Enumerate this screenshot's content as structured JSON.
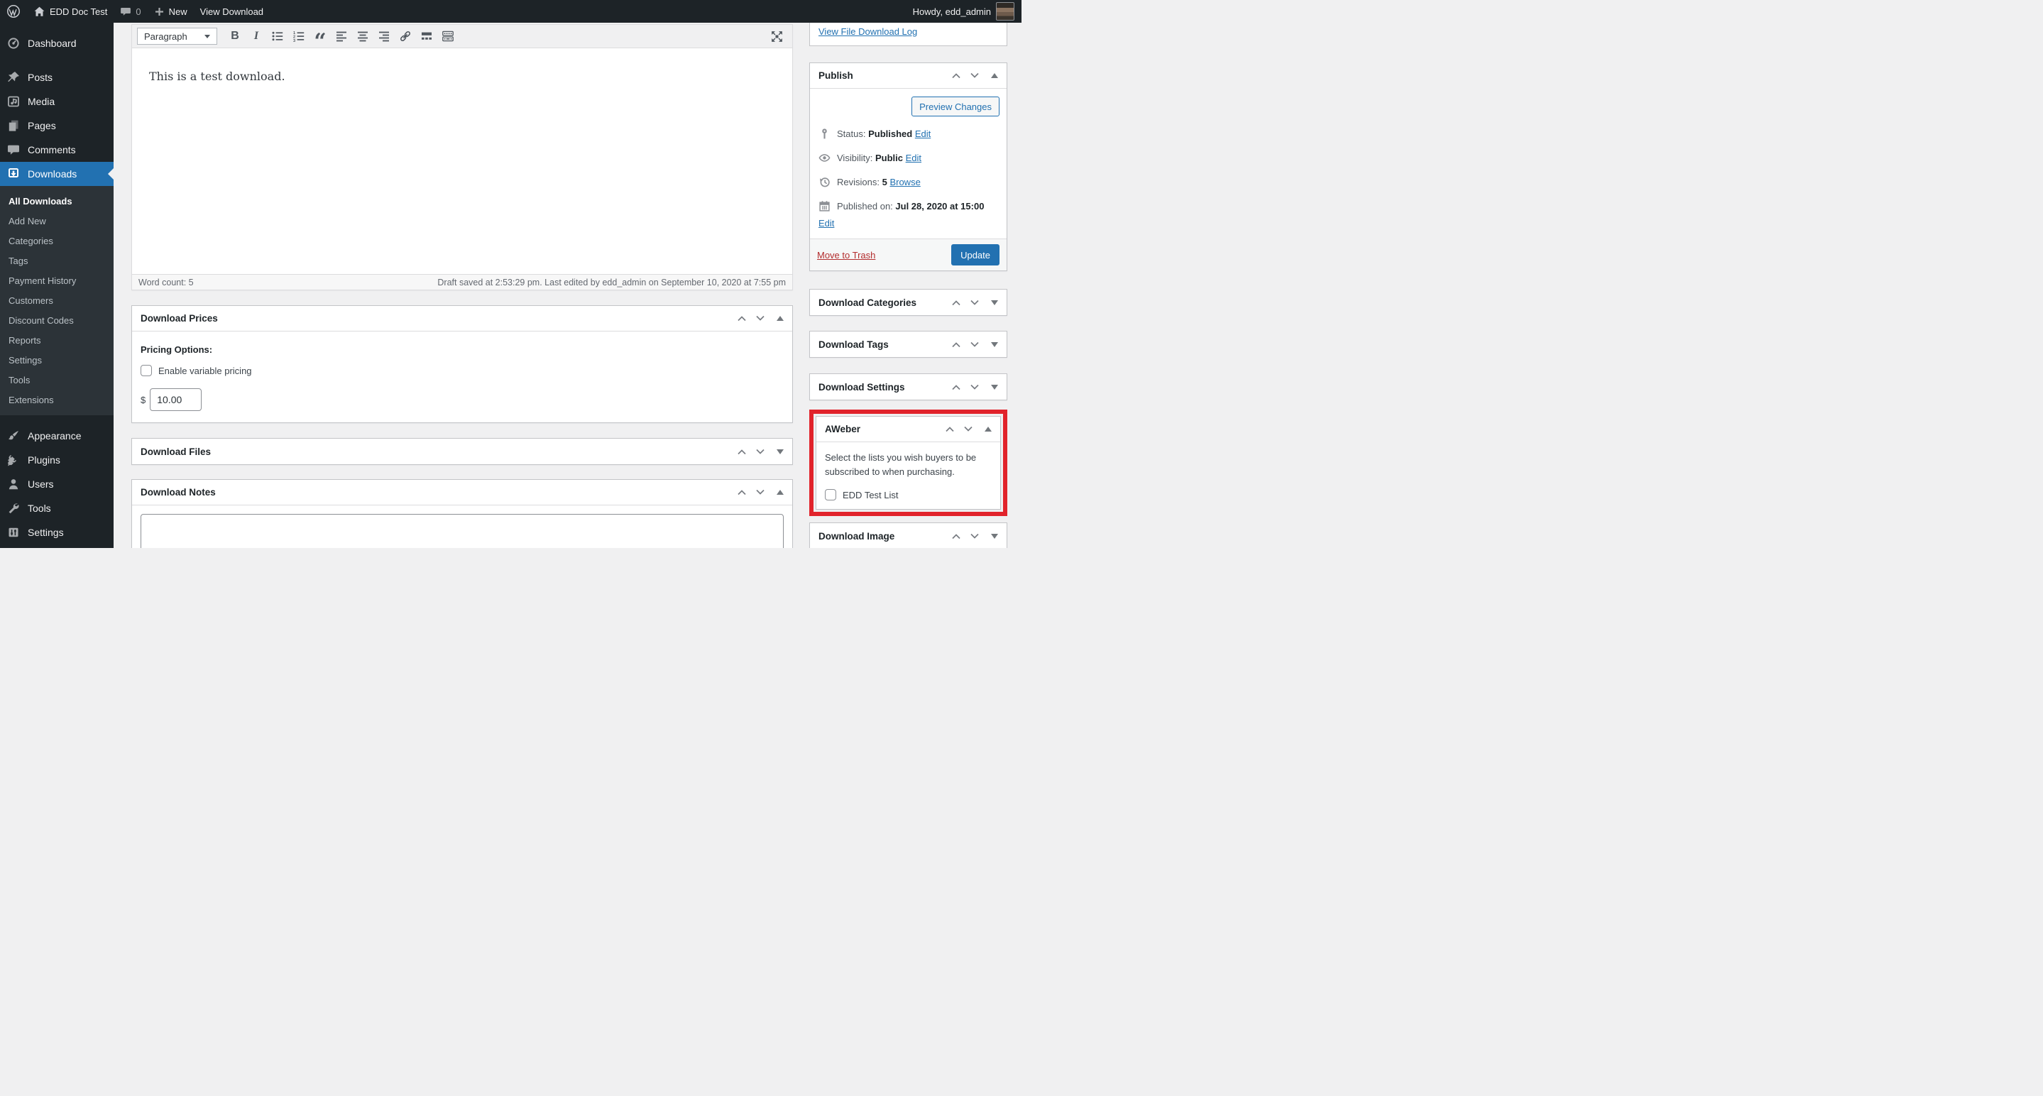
{
  "admin_bar": {
    "site_name": "EDD Doc Test",
    "comments_count": "0",
    "new_label": "New",
    "view_download_label": "View Download",
    "howdy_text": "Howdy, edd_admin"
  },
  "sidebar": {
    "items": [
      {
        "label": "Dashboard"
      },
      {
        "label": "Posts"
      },
      {
        "label": "Media"
      },
      {
        "label": "Pages"
      },
      {
        "label": "Comments"
      },
      {
        "label": "Downloads",
        "active": true
      },
      {
        "label": "Appearance"
      },
      {
        "label": "Plugins"
      },
      {
        "label": "Users"
      },
      {
        "label": "Tools"
      },
      {
        "label": "Settings"
      }
    ],
    "submenu": [
      {
        "label": "All Downloads",
        "current": true
      },
      {
        "label": "Add New"
      },
      {
        "label": "Categories"
      },
      {
        "label": "Tags"
      },
      {
        "label": "Payment History"
      },
      {
        "label": "Customers"
      },
      {
        "label": "Discount Codes"
      },
      {
        "label": "Reports"
      },
      {
        "label": "Settings"
      },
      {
        "label": "Tools"
      },
      {
        "label": "Extensions"
      }
    ]
  },
  "editor": {
    "format_label": "Paragraph",
    "content": "This is a test download.",
    "word_count": "Word count: 5",
    "save_status": "Draft saved at 2:53:29 pm. Last edited by edd_admin on September 10, 2020 at 7:55 pm"
  },
  "boxes": {
    "log_link": "View File Download Log",
    "publish": {
      "title": "Publish",
      "preview_button": "Preview Changes",
      "status_label": "Status:",
      "status_value": "Published",
      "visibility_label": "Visibility:",
      "visibility_value": "Public",
      "revisions_label": "Revisions:",
      "revisions_value": "5",
      "browse_link": "Browse",
      "published_label": "Published on:",
      "published_value": "Jul 28, 2020 at 15:00",
      "edit_link": "Edit",
      "trash_link": "Move to Trash",
      "update_button": "Update"
    },
    "prices": {
      "title": "Download Prices",
      "pricing_options_label": "Pricing Options:",
      "variable_pricing_label": "Enable variable pricing",
      "currency_symbol": "$",
      "price_value": "10.00"
    },
    "files": {
      "title": "Download Files"
    },
    "notes": {
      "title": "Download Notes"
    },
    "categories": {
      "title": "Download Categories"
    },
    "tags": {
      "title": "Download Tags"
    },
    "settings": {
      "title": "Download Settings"
    },
    "aweber": {
      "title": "AWeber",
      "description": "Select the lists you wish buyers to be subscribed to when purchasing.",
      "list_label": "EDD Test List"
    },
    "image": {
      "title": "Download Image"
    }
  },
  "colors": {
    "accent": "#2271b1",
    "admin_bar_bg": "#1d2327",
    "submenu_bg": "#2c3338",
    "page_bg": "#f0f0f1",
    "box_border": "#c3c4c7",
    "danger_link": "#b32d2e",
    "highlight_red": "#e1232b"
  }
}
